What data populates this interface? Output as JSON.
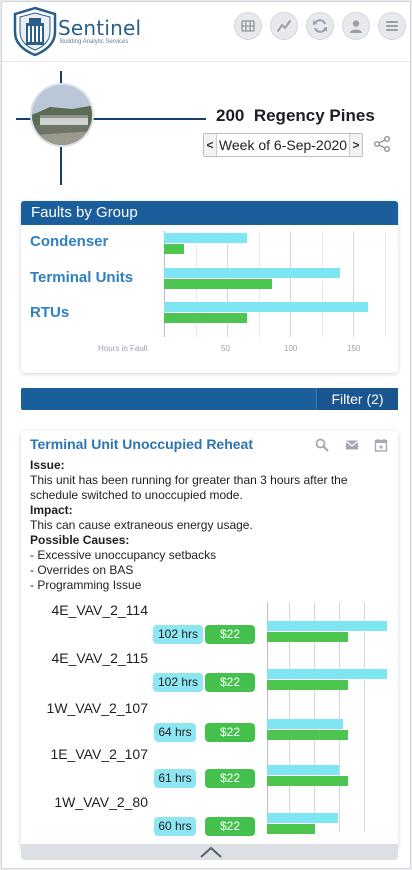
{
  "header": {
    "brand": "Sentinel",
    "brand_sub": "Building Analytic Services",
    "buttons": [
      "grid-icon",
      "trend-icon",
      "refresh-icon",
      "user-icon",
      "menu-icon"
    ]
  },
  "property": {
    "number": "200",
    "name": "Regency Pines",
    "week_label": "Week of 6-Sep-2020",
    "prev": "<",
    "next": ">"
  },
  "faults_card": {
    "title": "Faults by Group",
    "x_axis_label": "Hours in Fault"
  },
  "chart_data": {
    "type": "bar",
    "categories": [
      "Condenser",
      "Terminal Units",
      "RTUs"
    ],
    "series": [
      {
        "values": [
          66,
          140,
          162
        ],
        "color": "#7ee6f2"
      },
      {
        "values": [
          16,
          86,
          66
        ],
        "color": "#4dc550"
      }
    ],
    "xlabel": "Hours in Fault",
    "xticks": [
      50,
      100,
      150
    ],
    "xlim": [
      0,
      175
    ],
    "grid": true
  },
  "filter": {
    "label": "Filter (2)"
  },
  "issue_card": {
    "title": "Terminal Unit Unoccupied Reheat",
    "issue_label": "Issue:",
    "issue_text": "This unit has been running for greater than 3 hours after the schedule switched to unoccupied mode.",
    "impact_label": "Impact:",
    "impact_text": "This can cause extraneous energy usage.",
    "causes_label": "Possible Causes:",
    "causes": [
      "- Excessive unoccupancy setbacks",
      "- Overrides on BAS",
      "- Programming Issue"
    ],
    "units": [
      {
        "name": "4E_VAV_2_114",
        "hours": "102 hrs",
        "cost": "$22",
        "h": 102,
        "c": 22
      },
      {
        "name": "4E_VAV_2_115",
        "hours": "102 hrs",
        "cost": "$22",
        "h": 102,
        "c": 22
      },
      {
        "name": "1W_VAV_2_107",
        "hours": "64 hrs",
        "cost": "$22",
        "h": 64,
        "c": 22
      },
      {
        "name": "1E_VAV_2_107",
        "hours": "61 hrs",
        "cost": "$22",
        "h": 61,
        "c": 22
      },
      {
        "name": "1W_VAV_2_80",
        "hours": "60 hrs",
        "cost": "$22",
        "h": 60,
        "c": 13
      }
    ]
  }
}
